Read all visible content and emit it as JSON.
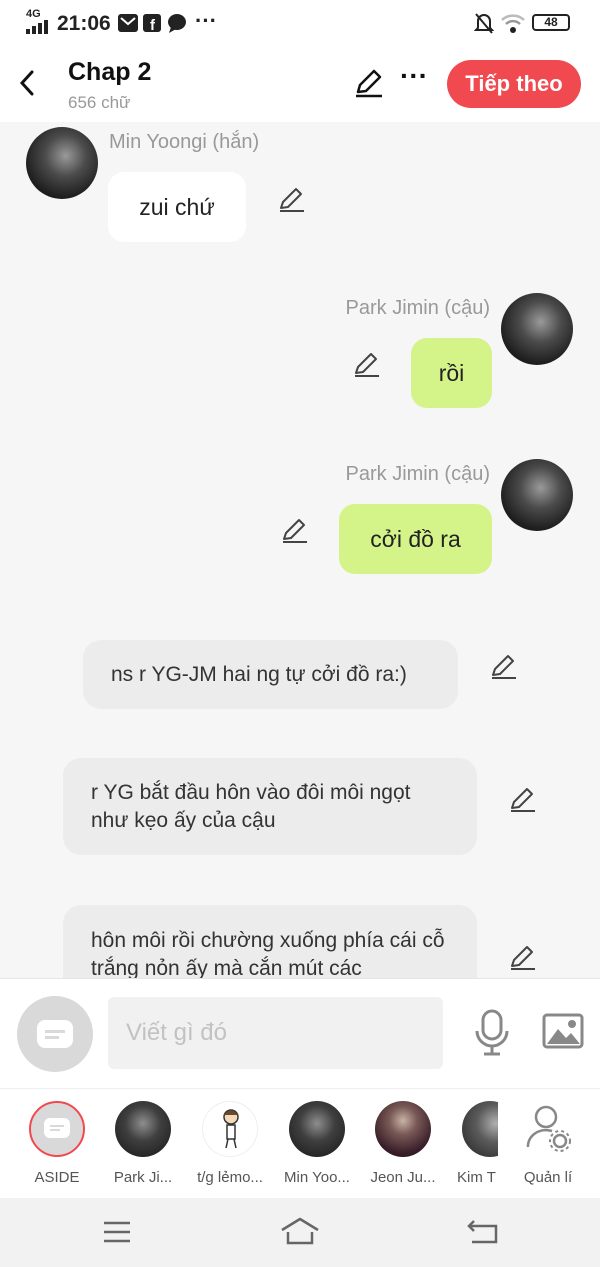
{
  "status_bar": {
    "network": "4G",
    "time": "21:06",
    "battery": "48"
  },
  "header": {
    "title": "Chap 2",
    "word_count": "656 chữ",
    "next_button": "Tiếp theo"
  },
  "messages": [
    {
      "speaker": "Min Yoongi (hắn)",
      "text": "zui chứ",
      "side": "left"
    },
    {
      "speaker": "Park Jimin (cậu)",
      "text": "rồi",
      "side": "right"
    },
    {
      "speaker": "Park Jimin (cậu)",
      "text": "cởi đồ ra",
      "side": "right"
    },
    {
      "text": "ns r YG-JM hai ng tự cởi đồ ra:)",
      "side": "narration"
    },
    {
      "text": "r YG bắt đầu hôn vào đôi môi ngọt như kẹo ấy của cậu",
      "side": "narration"
    },
    {
      "text": "hôn môi rồi chường xuống phía cái cỗ trắng nỏn ấy mà cắn mút các",
      "side": "narration"
    }
  ],
  "input": {
    "placeholder": "Viết gì đó"
  },
  "characters": [
    {
      "label": "ASIDE"
    },
    {
      "label": "Park Ji..."
    },
    {
      "label": "t/g lẻmo..."
    },
    {
      "label": "Min Yoo..."
    },
    {
      "label": "Jeon Ju..."
    },
    {
      "label": "Kim T"
    },
    {
      "label": "Quản lí"
    }
  ],
  "colors": {
    "accent": "#f04a50",
    "green_bubble": "#d4f48a"
  }
}
